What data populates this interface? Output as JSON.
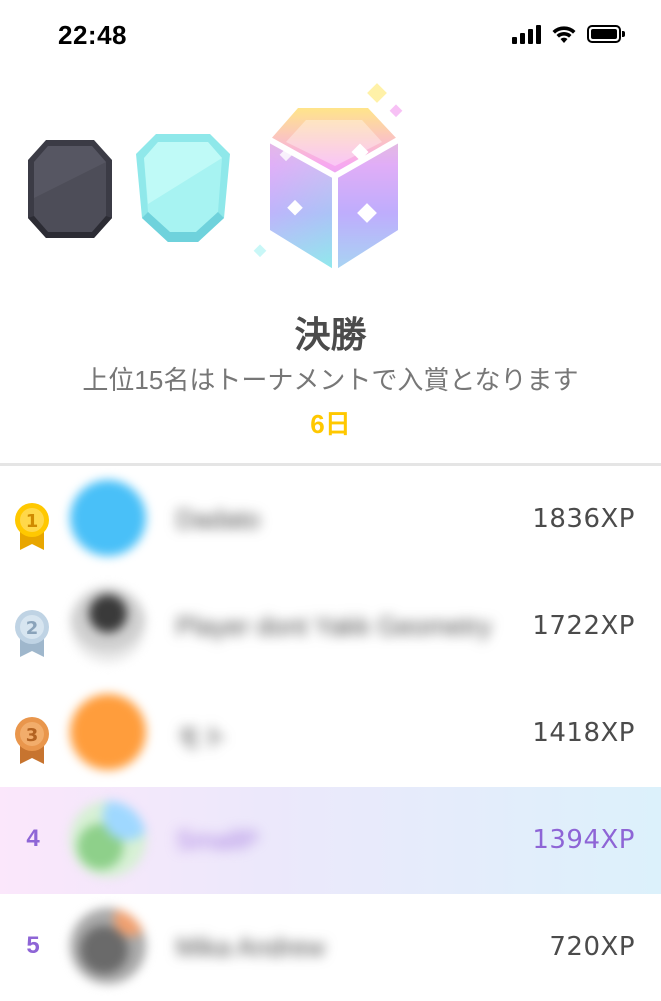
{
  "status_bar": {
    "time": "22:48",
    "icons": [
      "cellular-signal-icon",
      "wifi-icon",
      "battery-icon"
    ]
  },
  "league": {
    "badges": [
      "obsidian-league-badge-icon",
      "diamond-league-badge-icon",
      "tournament-crystal-badge-icon"
    ],
    "title": "決勝",
    "subtitle": "上位15名はトーナメントで入賞となります",
    "days_left": "6日",
    "accent_color": "#ffc800"
  },
  "leaderboard": {
    "rows": [
      {
        "rank": "1",
        "medal": "gold",
        "name": "Dadato",
        "xp": "1836XP",
        "avatar_color": "#49c0f8"
      },
      {
        "rank": "2",
        "medal": "silver",
        "name": "Player dont Yakk Geometry",
        "xp": "1722XP",
        "avatar_color": "#7a7a7a"
      },
      {
        "rank": "3",
        "medal": "bronze",
        "name": "モト",
        "xp": "1418XP",
        "avatar_color": "#ff9d3c"
      },
      {
        "rank": "4",
        "medal": "",
        "name": "SmallP",
        "xp": "1394XP",
        "avatar_color": "#8ed08a",
        "highlighted": true
      },
      {
        "rank": "5",
        "medal": "",
        "name": "Mika Andrew",
        "xp": "720XP",
        "avatar_color": "#8a8a8a"
      }
    ],
    "highlight_color": "#8e65d6"
  }
}
